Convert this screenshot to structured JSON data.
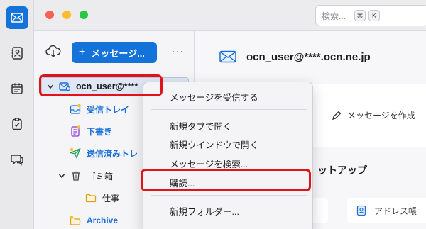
{
  "titlebar": {
    "search_placeholder": "検索...",
    "shortcut_key1": "⌘",
    "shortcut_key2": "K"
  },
  "folder_pane": {
    "new_message_plus": "+",
    "new_message_label": "メッセージ...",
    "more_label": "···",
    "account": "ocn_user@****",
    "folders": {
      "inbox": "受信トレイ",
      "drafts": "下書き",
      "sent": "送信済みトレ",
      "trash": "ゴミ箱",
      "work": "仕事",
      "archive": "Archive"
    }
  },
  "main": {
    "account_header": "ocn_user@****.ocn.ne.jp",
    "write_message": "メッセージを作成",
    "setup_title": "ットアップ",
    "address_book": "アドレス帳"
  },
  "context_menu": {
    "items": [
      "メッセージを受信する",
      "新規タブで開く",
      "新規ウインドウで開く",
      "メッセージを検索...",
      "購読...",
      "新規フォルダー..."
    ]
  },
  "colors": {
    "accent": "#1373d9",
    "highlight": "#e0131b"
  }
}
